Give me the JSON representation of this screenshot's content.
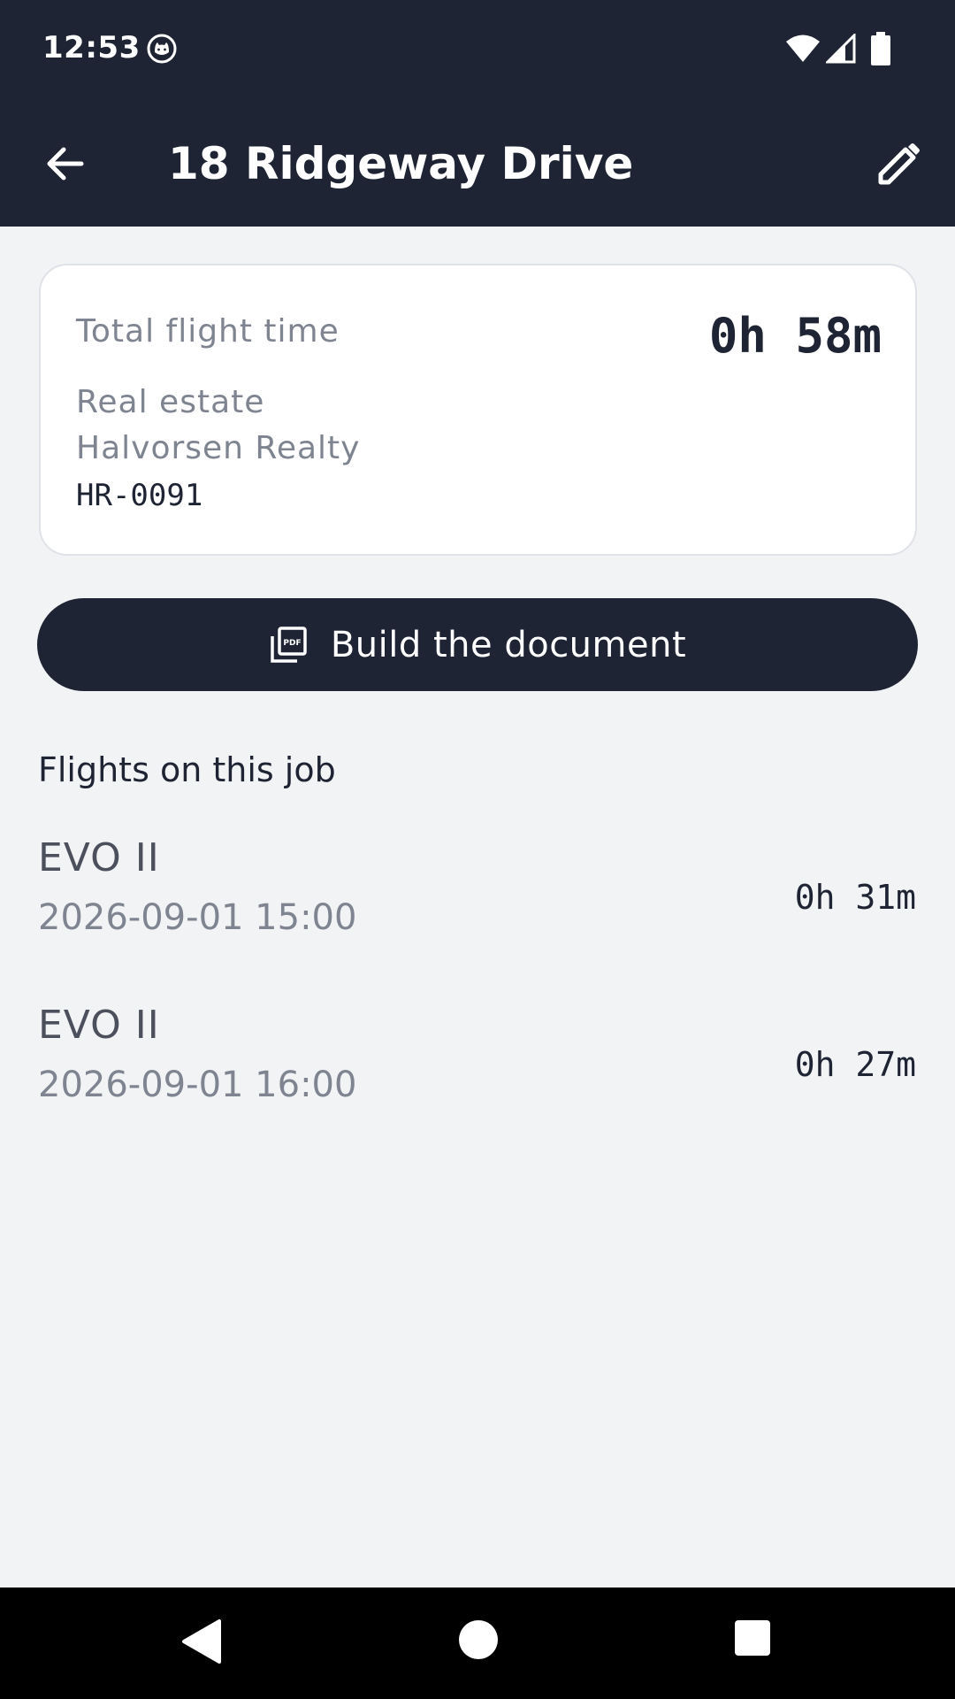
{
  "status_bar": {
    "time": "12:53",
    "icons": [
      "cat-notification-icon",
      "wifi-icon",
      "signal-icon",
      "battery-icon"
    ]
  },
  "app_bar": {
    "title": "18 Ridgeway Drive",
    "back_icon": "arrow-back-icon",
    "edit_icon": "pencil-icon"
  },
  "summary": {
    "total_label": "Total flight time",
    "total_value": "0h 58m",
    "category": "Real estate",
    "client": "Halvorsen Realty",
    "code": "HR-0091"
  },
  "actions": {
    "build_label": "Build the document",
    "build_icon": "pdf-icon"
  },
  "flights": {
    "heading": "Flights on this job",
    "items": [
      {
        "model": "EVO II",
        "datetime": "2026-09-01 15:00",
        "duration": "0h 31m"
      },
      {
        "model": "EVO II",
        "datetime": "2026-09-01 16:00",
        "duration": "0h 27m"
      }
    ]
  },
  "colors": {
    "primary_dark": "#1e2433",
    "background": "#f2f3f5",
    "card": "#ffffff",
    "muted_text": "#7f8491"
  }
}
